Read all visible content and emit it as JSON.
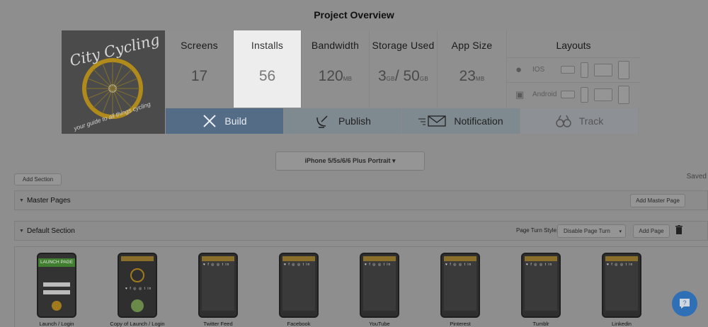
{
  "page_title": "Project Overview",
  "logo": {
    "line1": "City Cycling",
    "tagline": "your guide to all things cycling"
  },
  "stats": [
    {
      "label": "Screens",
      "value": "17",
      "unit": ""
    },
    {
      "label": "Installs",
      "value": "56",
      "unit": ""
    },
    {
      "label": "Bandwidth",
      "value": "120",
      "unit": "MB"
    },
    {
      "label": "Storage Used",
      "value": "3",
      "unit": "GB",
      "value2": "/ 50",
      "unit2": "GB"
    },
    {
      "label": "App Size",
      "value": "23",
      "unit": "MB"
    }
  ],
  "layouts": {
    "label": "Layouts",
    "ios": "IOS",
    "android": "Android"
  },
  "actions": {
    "build": "Build",
    "publish": "Publish",
    "notification": "Notification",
    "track": "Track"
  },
  "device_select": "iPhone 5/5s/6/6 Plus Portrait ▾",
  "add_section": "Add Section",
  "saved": "Saved",
  "master_pages": {
    "title": "Master Pages",
    "add": "Add Master Page"
  },
  "default_section": {
    "title": "Default Section",
    "turn_style_label": "Page Turn Style:",
    "turn_style_value": "Disable Page Turn",
    "add_page": "Add Page"
  },
  "screens": [
    {
      "label": "Launch / Login",
      "badge": "LAUNCH PAGE"
    },
    {
      "label": "Copy of Launch / Login"
    },
    {
      "label": "Twitter Feed"
    },
    {
      "label": "Facebook"
    },
    {
      "label": "YouTube"
    },
    {
      "label": "Pinterest"
    },
    {
      "label": "Tumblr"
    },
    {
      "label": "Linkedin"
    }
  ],
  "social_icons": "♥ f ◎ ◎ t in",
  "help_icon": "?",
  "colors": {
    "build_active": "#546c85",
    "help_button": "#2f6fb6",
    "installs_highlight": "#ededed"
  }
}
